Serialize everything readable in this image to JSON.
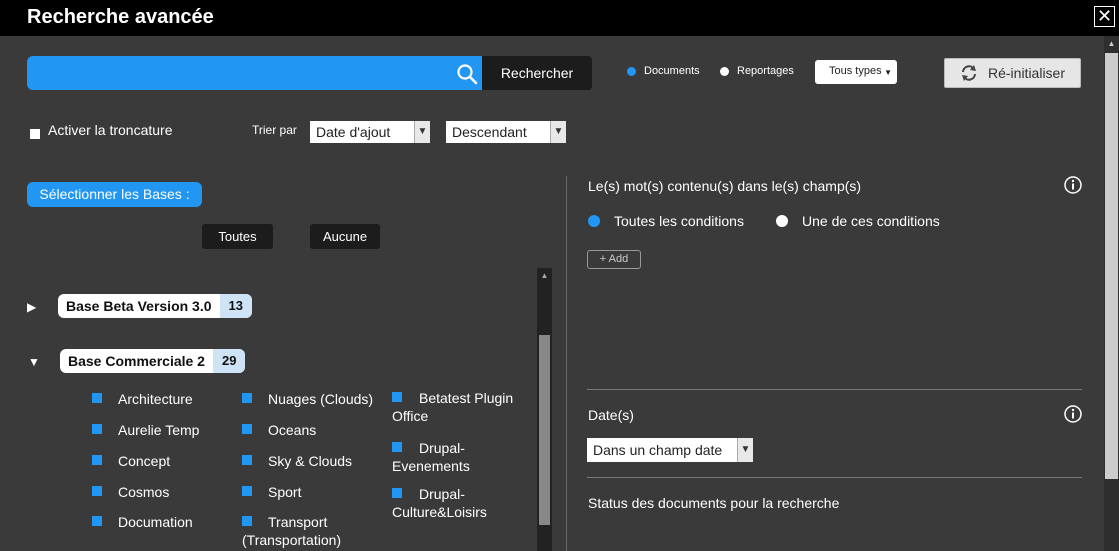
{
  "window": {
    "title": "Recherche avancée",
    "close_label": "✕"
  },
  "search": {
    "value": "",
    "button_label": "Rechercher"
  },
  "types": {
    "documents_label": "Documents",
    "reportages_label": "Reportages",
    "select_value": "Tous types",
    "documents_color": "#2196f3",
    "reportages_color": "#ffffff"
  },
  "reset": {
    "label": "Ré-initialiser"
  },
  "options": {
    "truncation_label": "Activer la troncature",
    "sort_label": "Trier par",
    "sort_field": "Date d'ajout",
    "sort_order": "Descendant"
  },
  "bases": {
    "header": "Sélectionner les Bases :",
    "all_label": "Toutes",
    "none_label": "Aucune",
    "items": [
      {
        "name": "Base Beta Version 3.0",
        "count": "13",
        "expanded": false
      },
      {
        "name": "Base Commerciale 2",
        "count": "29",
        "expanded": true
      }
    ],
    "categories_col1": [
      "Architecture",
      "Aurelie Temp",
      "Concept",
      "Cosmos",
      "Documation"
    ],
    "categories_col2": [
      "Nuages (Clouds)",
      "Oceans",
      "Sky & Clouds",
      "Sport",
      "Transport (Transportation)"
    ],
    "categories_col3": [
      "Betatest Plugin Office",
      "Drupal-Evenements",
      "Drupal-Culture&Loisirs"
    ]
  },
  "fields": {
    "title": "Le(s) mot(s) contenu(s) dans le(s) champ(s)",
    "all_conditions": "Toutes les conditions",
    "any_condition": "Une de ces conditions",
    "add_label": "+ Add"
  },
  "dates": {
    "title": "Date(s)",
    "select_value": "Dans un champ date"
  },
  "status": {
    "title": "Status des documents pour la recherche"
  },
  "colors": {
    "accent": "#2196f3",
    "background": "#3a3a3a",
    "titlebar": "#000000"
  }
}
